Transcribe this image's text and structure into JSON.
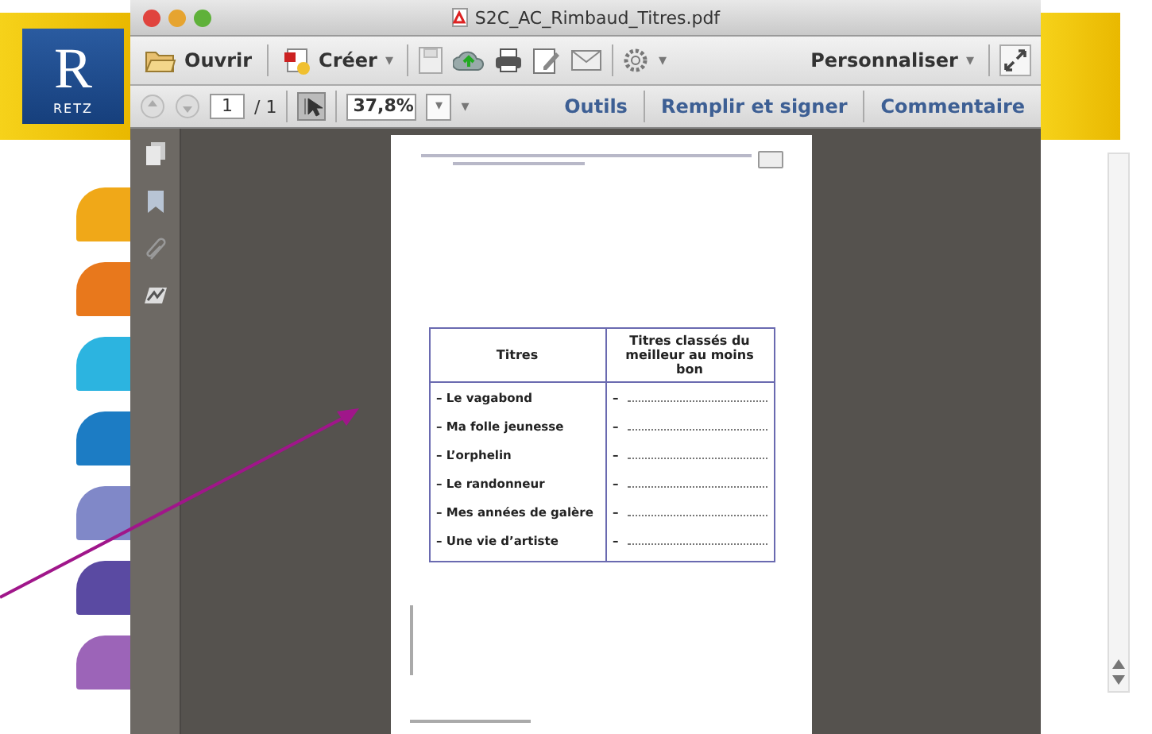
{
  "logo": {
    "letter": "R",
    "text": "RETZ"
  },
  "side_tabs": [
    {
      "color": "#f0a818"
    },
    {
      "color": "#e8781c"
    },
    {
      "color": "#2cb4e0"
    },
    {
      "color": "#1c7cc4"
    },
    {
      "color": "#8088c8"
    },
    {
      "color": "#5a4aa2"
    },
    {
      "color": "#9c64b8"
    }
  ],
  "window": {
    "title": "S2C_AC_Rimbaud_Titres.pdf"
  },
  "toolbar": {
    "open": "Ouvrir",
    "create": "Créer",
    "dropdown": "▾",
    "customize": "Personnaliser"
  },
  "navbar": {
    "page": "1",
    "page_total": "/ 1",
    "zoom": "37,8%",
    "links": [
      "Outils",
      "Remplir et signer",
      "Commentaire"
    ]
  },
  "document": {
    "table": {
      "columns": [
        "Titres",
        "Titres classés du meilleur au moins bon"
      ],
      "rows": [
        {
          "title": "– Le vagabond",
          "answer": "–"
        },
        {
          "title": "– Ma folle jeunesse",
          "answer": "–"
        },
        {
          "title": "– L’orphelin",
          "answer": "–"
        },
        {
          "title": "– Le randonneur",
          "answer": "–"
        },
        {
          "title": "– Mes années de galère",
          "answer": "–"
        },
        {
          "title": "– Une vie d’artiste",
          "answer": "–"
        }
      ]
    }
  }
}
